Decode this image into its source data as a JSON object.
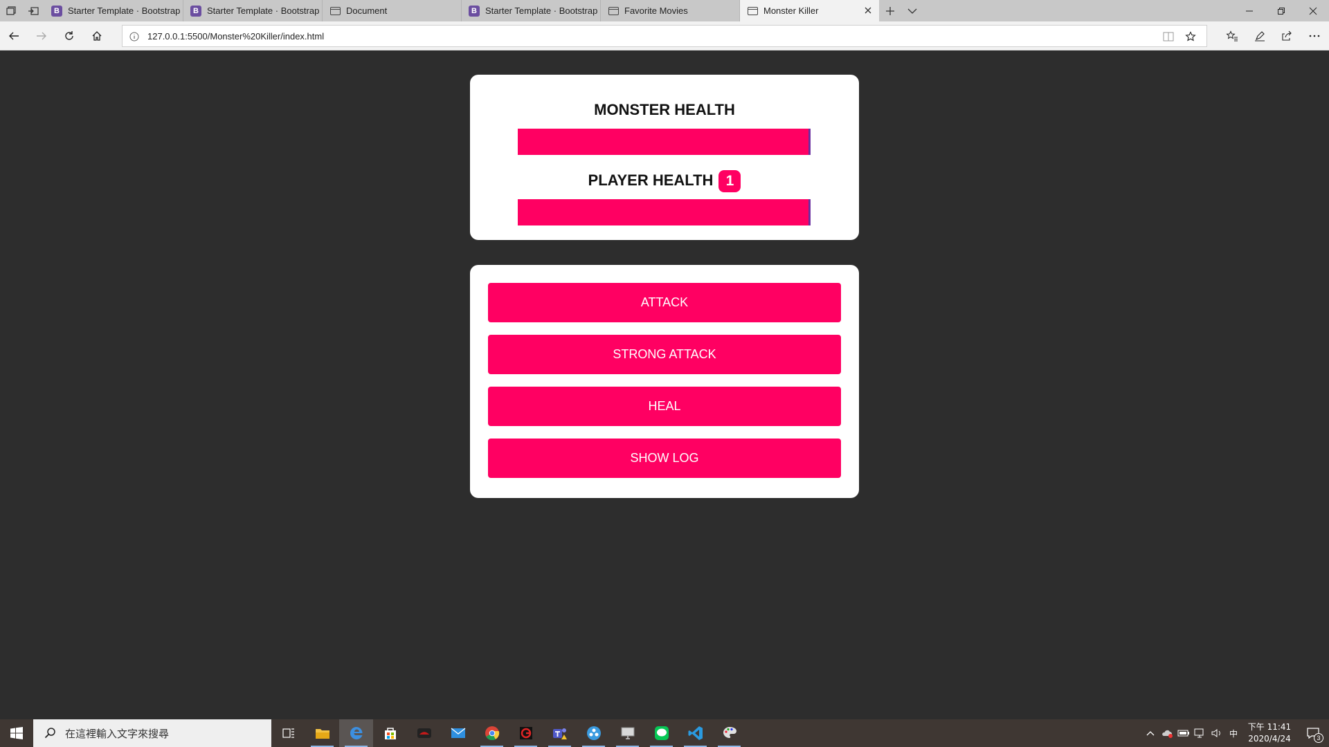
{
  "browser": {
    "tabs": [
      {
        "title": "Starter Template · Bootstrap",
        "favicon": "bootstrap-icon"
      },
      {
        "title": "Starter Template · Bootstrap",
        "favicon": "bootstrap-icon"
      },
      {
        "title": "Document",
        "favicon": "page-icon"
      },
      {
        "title": "Starter Template · Bootstrap",
        "favicon": "bootstrap-icon"
      },
      {
        "title": "Favorite Movies",
        "favicon": "page-icon"
      },
      {
        "title": "Monster Killer",
        "favicon": "page-icon",
        "active": true
      }
    ],
    "favicon_letter": "B",
    "url": "127.0.0.1:5500/Monster%20Killer/index.html"
  },
  "game": {
    "monster_health_label": "MONSTER HEALTH",
    "monster_health_value": 1.0,
    "player_health_label": "PLAYER HEALTH",
    "player_bonus_lives": "1",
    "player_health_value": 1.0,
    "buttons": {
      "attack": "ATTACK",
      "strong_attack": "STRONG ATTACK",
      "heal": "HEAL",
      "show_log": "SHOW LOG"
    }
  },
  "taskbar": {
    "search_placeholder": "在這裡輸入文字來搜尋",
    "ime": "中",
    "time": "下午 11:41",
    "date": "2020/4/24",
    "notifications": "3"
  },
  "colors": {
    "accent": "#ff0062",
    "page_bg": "#2d2d2d",
    "card_bg": "#ffffff"
  }
}
